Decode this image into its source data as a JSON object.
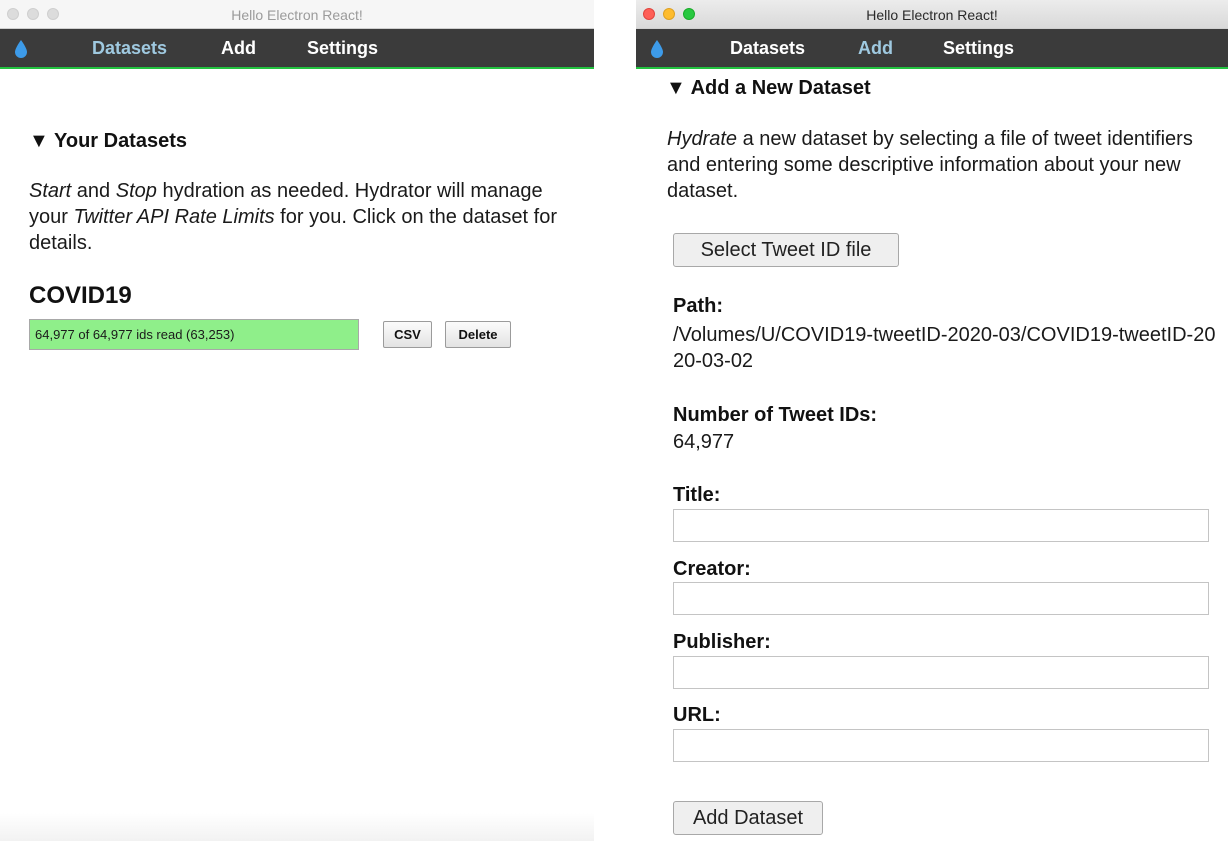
{
  "left_window": {
    "title": "Hello Electron React!",
    "nav": {
      "datasets": "Datasets",
      "add": "Add",
      "settings": "Settings",
      "active": "Datasets"
    },
    "section_heading": "▼ Your Datasets",
    "description": {
      "start": "Start",
      "and": " and ",
      "stop": "Stop",
      "mid": " hydration as needed. Hydrator will manage your ",
      "rate_limits": "Twitter API Rate Limits",
      "end": " for you. Click on the dataset for details."
    },
    "dataset": {
      "name": "COVID19",
      "progress_text": "64,977 of 64,977 ids read (63,253)",
      "progress_fraction": 1.0,
      "csv_button": "CSV",
      "delete_button": "Delete"
    }
  },
  "right_window": {
    "title": "Hello Electron React!",
    "nav": {
      "datasets": "Datasets",
      "add": "Add",
      "settings": "Settings",
      "active": "Add"
    },
    "section_heading": "▼ Add a New Dataset",
    "description": {
      "hydrate": "Hydrate",
      "rest": " a new dataset by selecting a file of tweet identifiers and entering some descriptive information about your new dataset."
    },
    "select_file_button": "Select Tweet ID file",
    "path_label": "Path:",
    "path_value": "/Volumes/U/COVID19-tweetID-2020-03/COVID19-tweetID-2020-03-02",
    "count_label": "Number of Tweet IDs:",
    "count_value": "64,977",
    "fields": {
      "title_label": "Title:",
      "title_value": "",
      "creator_label": "Creator:",
      "creator_value": "",
      "publisher_label": "Publisher:",
      "publisher_value": "",
      "url_label": "URL:",
      "url_value": ""
    },
    "add_button": "Add Dataset"
  },
  "colors": {
    "navbar_bg": "#3b3b3b",
    "navbar_accent": "#22c23f",
    "nav_active": "#9fc9e0",
    "progress_fill": "#8fef8a",
    "drop_icon": "#3d9be9"
  },
  "icons": [
    "water-drop-icon"
  ]
}
